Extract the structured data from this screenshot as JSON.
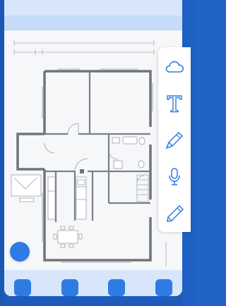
{
  "app": {
    "name": "",
    "accent_color": "#2E7BE3",
    "background_color": "#1F63C4"
  },
  "canvas": {
    "content": "floor-plan"
  },
  "tools": [
    {
      "name": "cloud-icon"
    },
    {
      "name": "text-tool-icon"
    },
    {
      "name": "pen-icon"
    },
    {
      "name": "microphone-icon"
    },
    {
      "name": "pencil-icon"
    }
  ],
  "bottom_nav": {
    "buttons": [
      {
        "name": "nav-button-1"
      },
      {
        "name": "nav-button-2"
      },
      {
        "name": "nav-button-3"
      },
      {
        "name": "nav-button-4"
      }
    ]
  },
  "fab": {
    "name": "floating-action-button"
  }
}
